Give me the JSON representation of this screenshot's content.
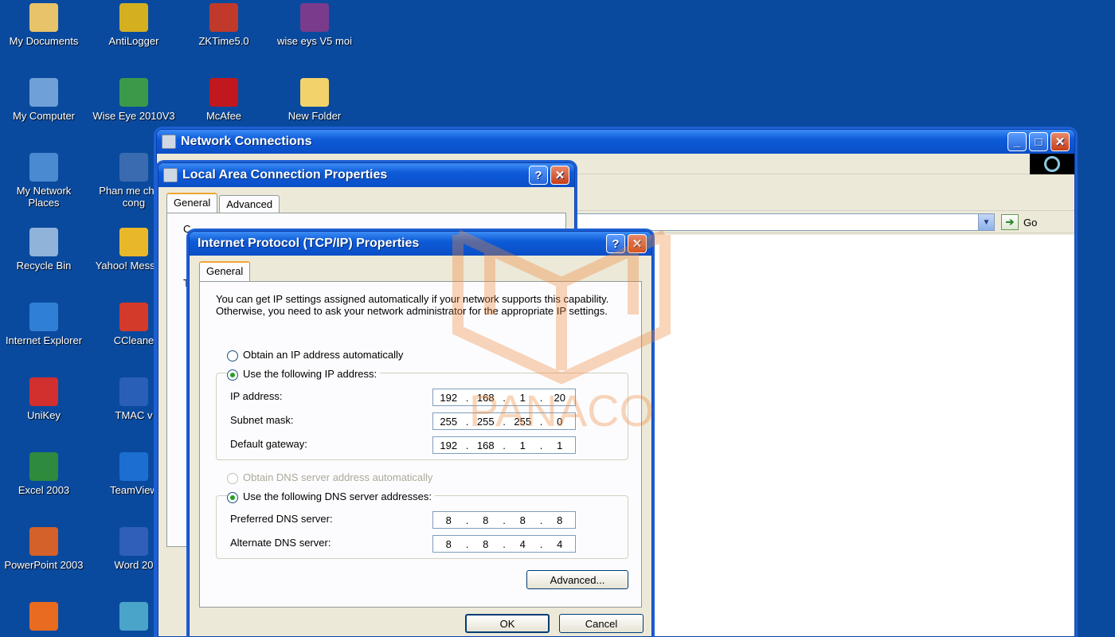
{
  "desktop": {
    "icons": [
      {
        "label": "My Documents",
        "icon": "my-documents-icon",
        "color": "#e8c36a"
      },
      {
        "label": "AntiLogger",
        "icon": "antilogger-icon",
        "color": "#d4b020"
      },
      {
        "label": "ZKTime5.0",
        "icon": "zktime-icon",
        "color": "#c0392b"
      },
      {
        "label": "wise eys V5 moi",
        "icon": "archive-icon",
        "color": "#7a3b8c"
      },
      {
        "label": "My Computer",
        "icon": "my-computer-icon",
        "color": "#6fa0d8"
      },
      {
        "label": "Wise Eye 2010V3",
        "icon": "wise-eye-icon",
        "color": "#3a9a4a"
      },
      {
        "label": "McAfee",
        "icon": "mcafee-icon",
        "color": "#c0181e"
      },
      {
        "label": "New Folder",
        "icon": "folder-icon",
        "color": "#f2d36b"
      },
      {
        "label": "My Network Places",
        "icon": "network-places-icon",
        "color": "#4a8ad0"
      },
      {
        "label": "Phan me cham cong",
        "icon": "attendance-app-icon",
        "color": "#3a6ab0"
      },
      {
        "label": "Recycle Bin",
        "icon": "recycle-bin-icon",
        "color": "#8fb3d9"
      },
      {
        "label": "Yahoo! Messeng",
        "icon": "yahoo-messenger-icon",
        "color": "#e9b82a"
      },
      {
        "label": "Internet Explorer",
        "icon": "internet-explorer-icon",
        "color": "#2f7fd6"
      },
      {
        "label": "CCleane",
        "icon": "ccleaner-icon",
        "color": "#d33a2a"
      },
      {
        "label": "UniKey",
        "icon": "unikey-icon",
        "color": "#d22f2f"
      },
      {
        "label": "TMAC v",
        "icon": "tmac-icon",
        "color": "#2a5fb8"
      },
      {
        "label": "Excel 2003",
        "icon": "excel-icon",
        "color": "#2e8b3e"
      },
      {
        "label": "TeamView",
        "icon": "teamviewer-icon",
        "color": "#1c6fd1"
      },
      {
        "label": "PowerPoint 2003",
        "icon": "powerpoint-icon",
        "color": "#d4602a"
      },
      {
        "label": "Word 20",
        "icon": "word-icon",
        "color": "#2f5fb8"
      },
      {
        "label": "",
        "icon": "firefox-icon",
        "color": "#e86b1f"
      },
      {
        "label": "",
        "icon": "unknown-app-icon",
        "color": "#4aa3c8"
      }
    ]
  },
  "network_window": {
    "title": "Network Connections",
    "go_label": "Go"
  },
  "lac_window": {
    "title": "Local Area Connection Properties",
    "tabs": [
      "General",
      "Advanced"
    ],
    "partial_label_1": "C",
    "partial_label_2": "T"
  },
  "tcpip": {
    "title": "Internet Protocol (TCP/IP) Properties",
    "tab": "General",
    "description": "You can get IP settings assigned automatically if your network supports this capability. Otherwise, you need to ask your network administrator for the appropriate IP settings.",
    "opt_auto_ip": "Obtain an IP address automatically",
    "opt_manual_ip": "Use the following IP address:",
    "ip_label": "IP address:",
    "ip_value": [
      "192",
      "168",
      "1",
      "20"
    ],
    "subnet_label": "Subnet mask:",
    "subnet_value": [
      "255",
      "255",
      "255",
      "0"
    ],
    "gateway_label": "Default gateway:",
    "gateway_value": [
      "192",
      "168",
      "1",
      "1"
    ],
    "opt_auto_dns": "Obtain DNS server address automatically",
    "opt_manual_dns": "Use the following DNS server addresses:",
    "pref_dns_label": "Preferred DNS server:",
    "pref_dns_value": [
      "8",
      "8",
      "8",
      "8"
    ],
    "alt_dns_label": "Alternate DNS server:",
    "alt_dns_value": [
      "8",
      "8",
      "4",
      "4"
    ],
    "advanced_button": "Advanced...",
    "ok_button": "OK",
    "cancel_button": "Cancel"
  },
  "watermark_text": "PANACO"
}
